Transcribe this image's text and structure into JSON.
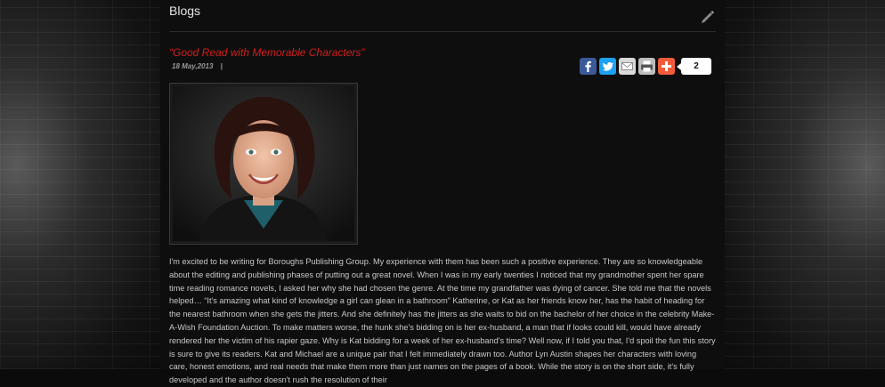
{
  "header": {
    "title": "Blogs",
    "edit_icon": "pencil-icon"
  },
  "post": {
    "title": "“Good Read with Memorable Characters”",
    "date": "18 May,2013",
    "separator": "|",
    "photo_icon": "author-portrait",
    "body": "I'm excited to be writing for Boroughs Publishing Group. My experience with them has been such a positive experience. They are so knowledgeable about the editing and publishing phases of putting out a great novel. When I was in my early twenties I noticed that my grandmother spent her spare time reading romance novels, I asked her why she had chosen the genre. At the time my grandfather was dying of cancer. She told me that the novels helped… “It's amazing what kind of knowledge a girl can glean in a bathroom” Katherine, or Kat as her friends know her, has the habit of heading for the nearest bathroom when she gets the jitters. And she definitely has the jitters as she waits to bid on the bachelor of her choice in the celebrity Make-A-Wish Foundation Auction. To make matters worse, the hunk she's bidding on is her ex-husband, a man that if looks could kill, would have already rendered her the victim of his rapier gaze. Why is Kat bidding for a week of her ex-husband's time? Well now, if I told you that, I'd spoil the fun this story is sure to give its readers. Kat and Michael are a unique pair that I felt immediately drawn too. Author Lyn Austin shapes her characters with loving care, honest emotions, and real needs that make them more than just names on the pages of a book. While the story is on the short side, it's fully developed and the author doesn't rush the resolution of their"
  },
  "share": {
    "buttons": [
      {
        "icon": "facebook-icon",
        "color": "#3b5998"
      },
      {
        "icon": "twitter-icon",
        "color": "#1da1f2"
      },
      {
        "icon": "email-icon",
        "color": "#d9d9d9"
      },
      {
        "icon": "print-icon",
        "color": "#bdbdbd"
      },
      {
        "icon": "addthis-plus-icon",
        "color": "#f15b3b"
      }
    ],
    "count": "2"
  },
  "colors": {
    "accent": "#d11f1f",
    "background": "#0e0e0e"
  }
}
